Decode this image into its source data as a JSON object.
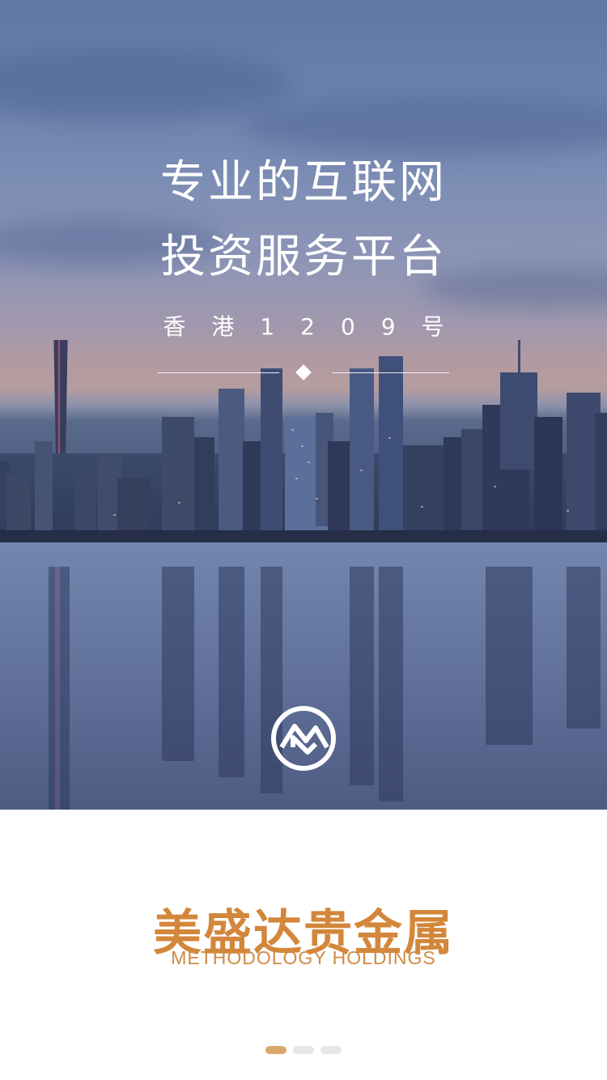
{
  "hero": {
    "headline": [
      "专业的互联网",
      "投资服务平台"
    ],
    "address": "香港1209号",
    "logo_icon": "methodology-logo-icon"
  },
  "brand": {
    "name": "美盛达贵金属",
    "name_en": "METHODOLOGY HOLDINGS",
    "accent_color": "#d3873b"
  },
  "pager": {
    "count": 3,
    "active_index": 0,
    "active_color": "#d9a86c",
    "inactive_color": "#e6e6e6"
  }
}
